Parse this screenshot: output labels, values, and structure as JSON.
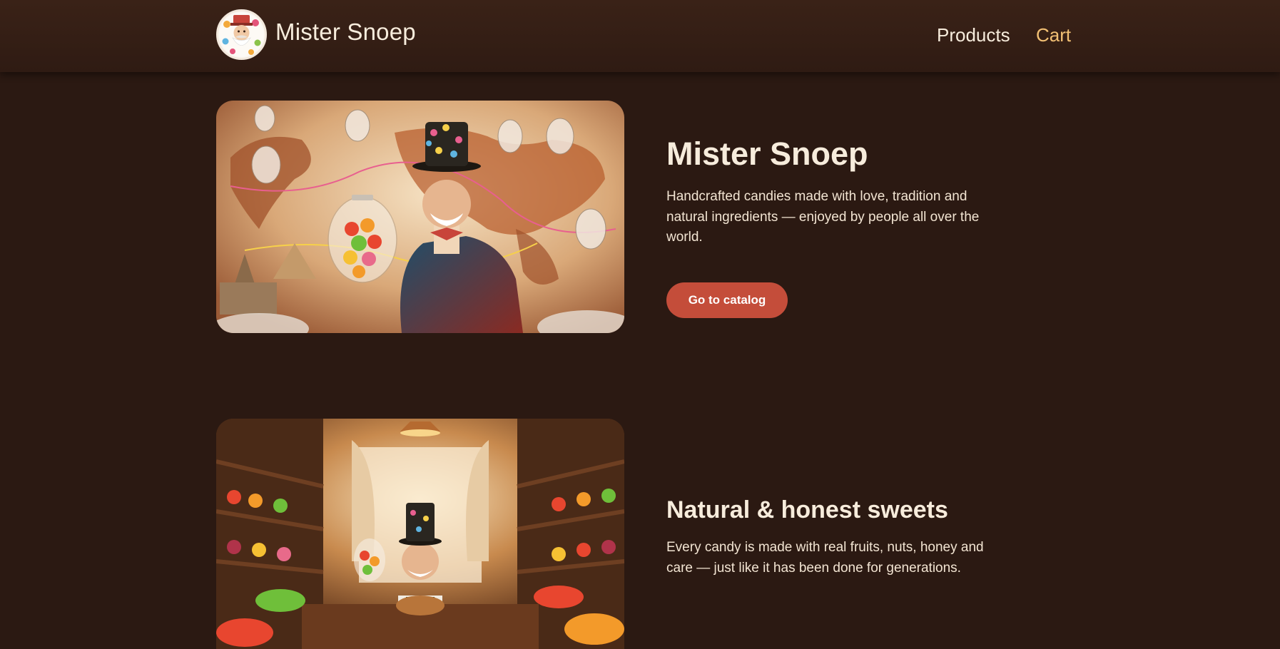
{
  "brand": {
    "name": "Mister Snoep",
    "logo_icon": "candy-man-logo-icon"
  },
  "nav": {
    "products": "Products",
    "cart": "Cart"
  },
  "hero": {
    "title": "Mister Snoep",
    "text": "Handcrafted candies made with love, tradition and natural ingredients — enjoyed by people all over the world.",
    "cta": "Go to catalog",
    "image_icon": "candy-man-world-map-image"
  },
  "about": {
    "title": "Natural & honest sweets",
    "text": "Every candy is made with real fruits, nuts, honey and care — just like it has been done for generations.",
    "image_icon": "candy-shop-image"
  },
  "colors": {
    "background": "#2b1912",
    "header": "#35201a",
    "accent": "#c44d3a",
    "cart_link": "#f2c074",
    "text": "#f2e4d2"
  }
}
